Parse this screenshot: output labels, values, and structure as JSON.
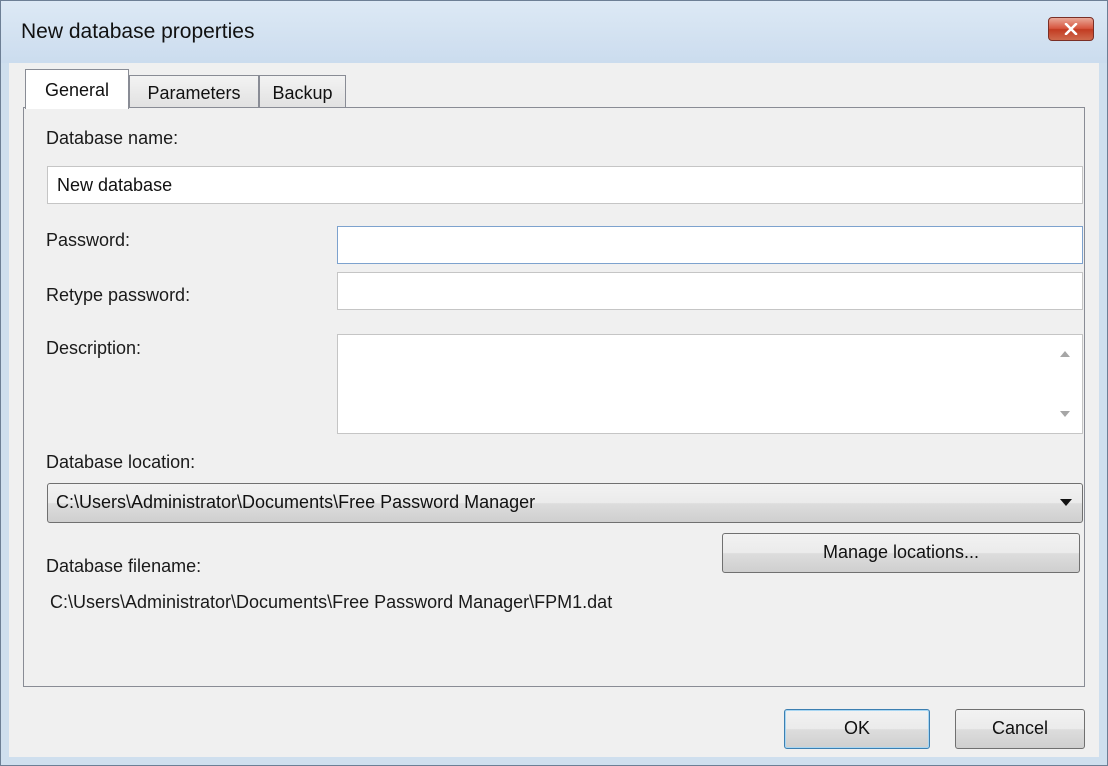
{
  "window": {
    "title": "New database properties"
  },
  "tabs": [
    {
      "label": "General",
      "active": true
    },
    {
      "label": "Parameters",
      "active": false
    },
    {
      "label": "Backup",
      "active": false
    }
  ],
  "general": {
    "database_name_label": "Database name:",
    "database_name_value": "New database",
    "password_label": "Password:",
    "password_value": "",
    "retype_password_label": "Retype password:",
    "retype_password_value": "",
    "description_label": "Description:",
    "description_value": "",
    "database_location_label": "Database location:",
    "database_location_value": "C:\\Users\\Administrator\\Documents\\Free Password Manager",
    "manage_locations_label": "Manage locations...",
    "database_filename_label": "Database filename:",
    "database_filename_value": "C:\\Users\\Administrator\\Documents\\Free Password Manager\\FPM1.dat"
  },
  "footer": {
    "ok_label": "OK",
    "cancel_label": "Cancel"
  },
  "icons": {
    "close": "close-icon",
    "dropdown": "chevron-down-icon",
    "scroll_up": "scroll-up-arrow-icon",
    "scroll_down": "scroll-down-arrow-icon"
  },
  "colors": {
    "titlebar": "#cbdcee",
    "close_button": "#c94a31",
    "dialog_background": "#f0f0f0",
    "focus_border": "#7da2ce",
    "default_button_border": "#3c7fb1"
  }
}
